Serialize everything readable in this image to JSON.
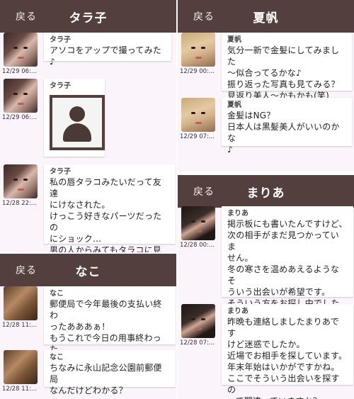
{
  "panels": [
    {
      "title": "タラ子",
      "back": "戻る",
      "messages": [
        {
          "name": "タラ子",
          "time": "12/29 06:...",
          "text": "アソコをアップで撮ってみた♪"
        },
        {
          "name": "タラ子",
          "time": "12/29 06:..."
        },
        {
          "name": "タラ子",
          "time": "12/28 22:...",
          "text": "私の唇タラコみたいだって友達\nにけなされた。\nけっこう好きなパーツだったの\nにショック…\n男の人からみてもタラコに見え\nますか？"
        }
      ]
    },
    {
      "title": "なこ",
      "back": "戻る",
      "messages": [
        {
          "name": "なこ",
          "time": "12/28 11:...",
          "text": "郵便局で今年最後の支払い終わ\nったあああぁ！\nもうこれで今日の用事終わった\nよ♪暇してない？"
        },
        {
          "name": "なこ",
          "time": "12/28 11:...",
          "text": "ちなみに永山記念公園前郵便局\nなんだけどわかる？"
        }
      ]
    },
    {
      "title": "夏帆",
      "back": "戻る",
      "messages": [
        {
          "name": "夏帆",
          "time": "12/29 00:...",
          "text": "気分一新で金髪にしてみました\n～似合ってるかな♪\n振り返った写真も見てみる？\n見返り美人～かもかも(笑)"
        },
        {
          "name": "夏帆",
          "time": "12/29 07:...",
          "text": "金髪はNG？\n日本人は黒髪美人がいいのかな\n♪"
        }
      ]
    },
    {
      "title": "まりあ",
      "back": "戻る",
      "messages": [
        {
          "name": "まりあ",
          "time": "12/28 00:...",
          "text": "掲示板にも書いたんですけど、\n次の相手がまだ見つかっていま\nせん。\n冬の寒さを温めあえるようなそ\nういう出会いが希望です。\nそういう方をお探し中でしたら\n是非お相手して下さい。"
        },
        {
          "name": "まりあ",
          "time": "12/28 07:...",
          "text": "昨晩も連絡しましたまりあです\nけど迷惑でしたか。\n近場でお相手を探しています。\n年末年始はいかがですかね。\nここでそういう出会いを探すの\nって間違っていますか？"
        }
      ]
    }
  ]
}
